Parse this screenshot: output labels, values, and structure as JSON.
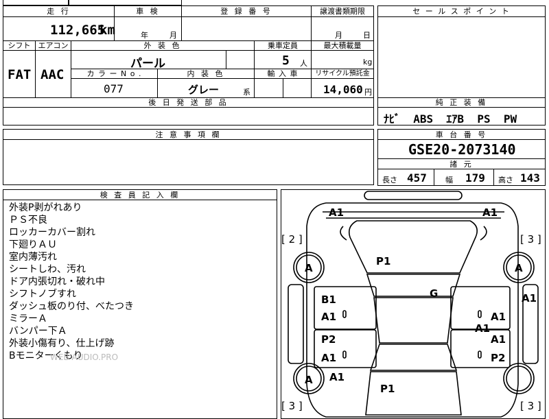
{
  "headers": {
    "mileage": "走 行",
    "inspection": "車 検",
    "registration_no": "登 録 番 号",
    "transfer_deadline": "譲渡書類期限",
    "sales_point": "セ ー ル ス ポ イ ン ト",
    "shift": "シフト",
    "aircon": "エアコン",
    "exterior_color": "外 装 色",
    "capacity": "乗車定員",
    "max_load": "最大積載量",
    "color_no": "カ ラ ー N o .",
    "interior_color": "内 装 色",
    "import": "輸 入 車",
    "recycle_fee": "リサイクル預託金",
    "later_parts": "後 日 発 送 部 品",
    "genuine_equipment": "純 正 装 備",
    "notes": "注 意 事 項 欄",
    "chassis_no": "車 台 番 号",
    "specs": "諸 元",
    "inspector_notes": "検 査 員 記 入 欄"
  },
  "values": {
    "mileage": "112,665",
    "mileage_unit": "km",
    "inspection_year": "年",
    "inspection_month": "月",
    "transfer_month": "月",
    "transfer_day": "日",
    "shift": "FAT",
    "aircon": "AAC",
    "exterior_color": "パール",
    "capacity": "5",
    "capacity_unit": "人",
    "max_load_unit": "kg",
    "color_no": "077",
    "interior_color": "グレー",
    "interior_suffix": "系",
    "recycle_fee": "14,060",
    "recycle_unit": "円",
    "equipment": "ﾅﾋﾞ  ABS  ｴｱB  PS  PW",
    "chassis_no": "GSE20-2073140",
    "length_label": "長さ",
    "length": "457",
    "width_label": "幅",
    "width": "179",
    "height_label": "高さ",
    "height": "143"
  },
  "inspector_notes": [
    "外装P剥がれあり",
    "ＰＳ不良",
    "ロッカーカバー割れ",
    "下廻りＡＵ",
    "室内薄汚れ",
    "シートしわ、汚れ",
    "ドア内張切れ・破れ中",
    "シフトノブすれ",
    "ダッシュ板のり付、べたつき",
    "ミラーＡ",
    "バンパー下Ａ",
    "外装小傷有り、仕上げ跡",
    "Bモニターくもり"
  ],
  "watermark": "WEB AUDIO.PRO",
  "diagram_labels": {
    "a1_top_left": "A1",
    "a1_top_right": "A1",
    "bracket_left_top": "[ 2 ]",
    "bracket_right_top": "[ 3 ]",
    "a_left_front": "A",
    "a_right_front": "A",
    "p1_hood": "P1",
    "a1_right_fender": "A1",
    "b1_left": "B1",
    "g_roof": "G",
    "a1_left_door1": "A1",
    "a1_right_door1": "A1",
    "a1_right_mid": "A1",
    "p2_left": "P2",
    "a1_right_door2": "A1",
    "a1_left_door2": "A1",
    "p2_right": "P2",
    "a_left_rear": "A",
    "a1_left_rear": "A1",
    "p1_trunk": "P1",
    "bracket_left_bottom": "[ 3 ]",
    "bracket_right_bottom": "[ 3 ]"
  }
}
